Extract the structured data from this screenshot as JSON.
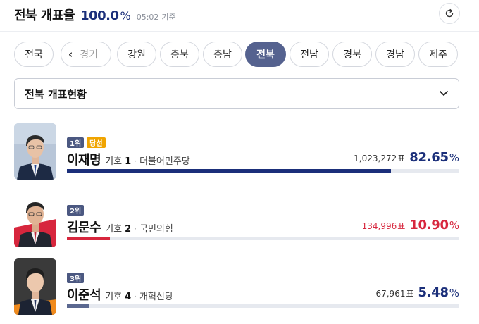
{
  "header": {
    "region_title": "전북 개표율",
    "percent": "100.0",
    "percent_unit": "%",
    "time": "05:02",
    "time_suffix": "기준"
  },
  "region_tabs": [
    {
      "label": "전국",
      "active": false
    },
    {
      "label": "경기",
      "active": false,
      "partial": true
    },
    {
      "label": "강원",
      "active": false
    },
    {
      "label": "충북",
      "active": false
    },
    {
      "label": "충남",
      "active": false
    },
    {
      "label": "전북",
      "active": true
    },
    {
      "label": "전남",
      "active": false
    },
    {
      "label": "경북",
      "active": false
    },
    {
      "label": "경남",
      "active": false
    },
    {
      "label": "제주",
      "active": false
    }
  ],
  "dropdown": {
    "selected": "전북 개표현황"
  },
  "candidates": [
    {
      "rank": "1위",
      "elected": "당선",
      "name": "이재명",
      "number_label": "기호",
      "number": "1",
      "party": "더불어민주당",
      "votes": "1,023,272",
      "votes_unit": "표",
      "percent": "82.65",
      "percent_unit": "%",
      "share": 0.8265,
      "color": "#1b2f7a"
    },
    {
      "rank": "2위",
      "name": "김문수",
      "number_label": "기호",
      "number": "2",
      "party": "국민의힘",
      "votes": "134,996",
      "votes_unit": "표",
      "percent": "10.90",
      "percent_unit": "%",
      "share": 0.109,
      "color": "#d7263d"
    },
    {
      "rank": "3위",
      "name": "이준석",
      "number_label": "기호",
      "number": "4",
      "party": "개혁신당",
      "votes": "67,961",
      "votes_unit": "표",
      "percent": "5.48",
      "percent_unit": "%",
      "share": 0.0548,
      "color": "#5b6890"
    }
  ]
}
